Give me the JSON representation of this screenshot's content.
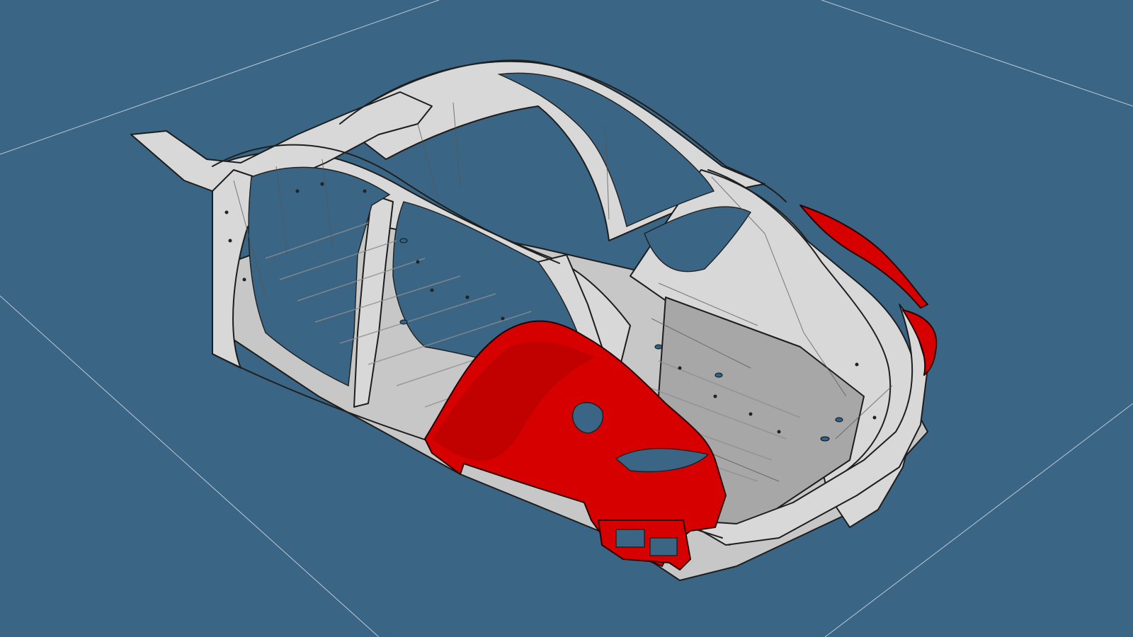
{
  "viewport": {
    "background_color": "#3b6584",
    "grid_color": "#d9e3ea"
  },
  "model": {
    "base_color": "#d8d8d8",
    "edge_color": "#1d1d1d",
    "highlight_color": "#d60000"
  }
}
